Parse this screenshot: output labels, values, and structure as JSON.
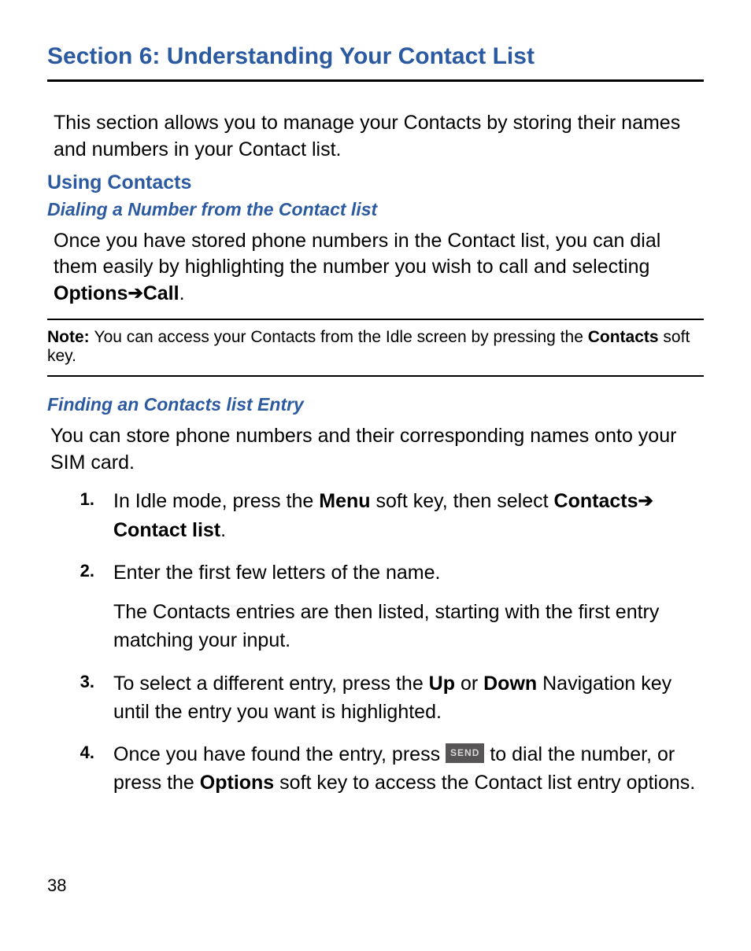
{
  "pageNumber": "38",
  "section": {
    "title": "Section 6: Understanding Your Contact List",
    "intro": "This section allows you to manage your Contacts by storing their names and numbers in your Contact list."
  },
  "h2": "Using Contacts",
  "sub1": {
    "title": "Dialing a Number from the Contact list",
    "para_a": "Once you have stored phone numbers in the Contact list, you can dial them easily by highlighting the number you wish to call and selecting ",
    "options": "Options",
    "arrow": " ➔ ",
    "call": "Call",
    "period": "."
  },
  "note": {
    "label": "Note: ",
    "text_a": "You can access your Contacts from the Idle screen by pressing the ",
    "contacts": "Contacts",
    "text_b": " soft key."
  },
  "sub2": {
    "title": "Finding an Contacts list Entry",
    "para": "You can store phone numbers and their corresponding names onto your SIM card."
  },
  "steps": {
    "n1": "1.",
    "s1a": "In Idle mode, press the ",
    "s1_menu": "Menu",
    "s1b": " soft key, then select ",
    "s1_contacts": "Contacts",
    "s1_arrow": " ➔ ",
    "s1_contactlist": "Contact list",
    "s1c": ".",
    "n2": "2.",
    "s2a": "Enter the first few letters of the name.",
    "s2b": "The Contacts entries are then listed, starting with the first entry matching your input.",
    "n3": "3.",
    "s3a": "To select a different entry, press the ",
    "s3_up": "Up",
    "s3b": " or ",
    "s3_down": "Down",
    "s3c": " Navigation key until the entry you want is highlighted.",
    "n4": "4.",
    "s4a": "Once you have found the entry, press ",
    "s4_send": "SEND",
    "s4b": " to dial the number, or press the ",
    "s4_options": "Options",
    "s4c": " soft key to access the Contact list entry options."
  }
}
